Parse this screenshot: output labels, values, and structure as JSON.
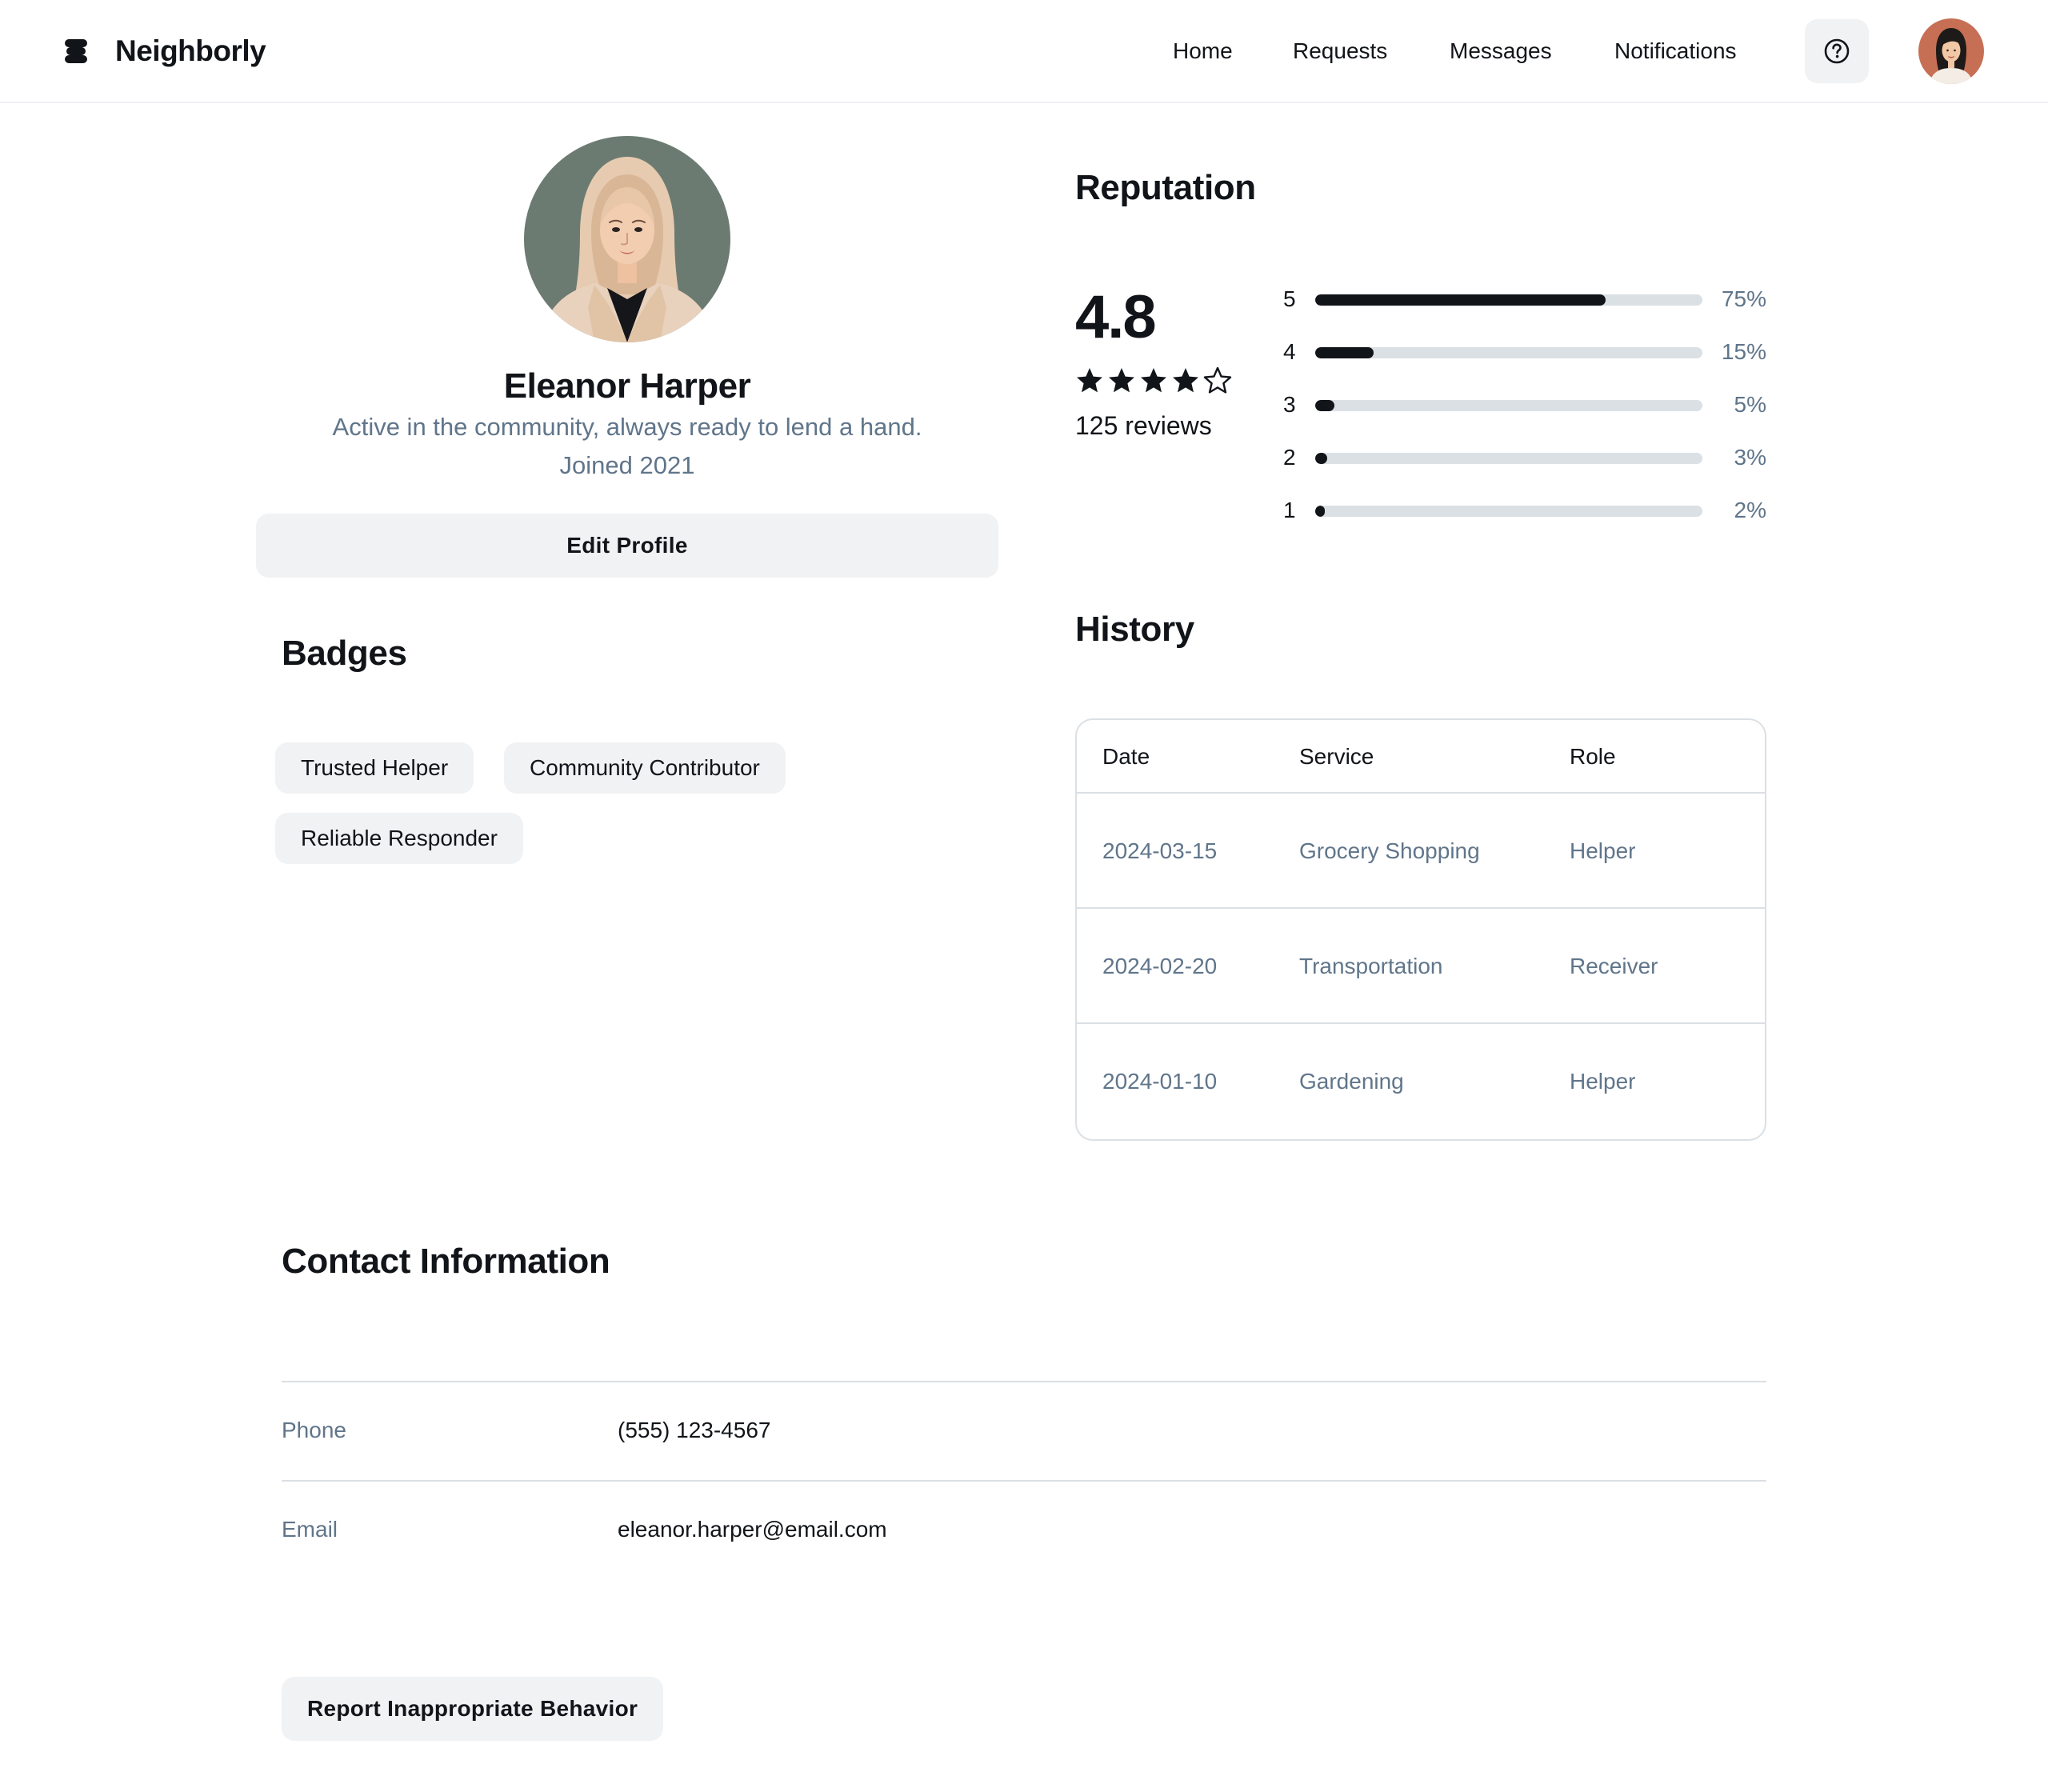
{
  "app": {
    "name": "Neighborly"
  },
  "nav": {
    "items": [
      {
        "label": "Home"
      },
      {
        "label": "Requests"
      },
      {
        "label": "Messages"
      },
      {
        "label": "Notifications"
      }
    ],
    "help_icon": "help-circle-icon"
  },
  "profile": {
    "name": "Eleanor Harper",
    "bio": "Active in the community, always ready to lend a hand.",
    "joined": "Joined 2021",
    "edit_label": "Edit Profile"
  },
  "badges": {
    "title": "Badges",
    "items": [
      "Trusted Helper",
      "Community Contributor",
      "Reliable Responder"
    ]
  },
  "reputation": {
    "title": "Reputation",
    "rating": "4.8",
    "stars_filled": 4,
    "stars_total": 5,
    "reviews": "125 reviews",
    "breakdown": [
      {
        "stars": "5",
        "percent": "75%",
        "value": 75
      },
      {
        "stars": "4",
        "percent": "15%",
        "value": 15
      },
      {
        "stars": "3",
        "percent": "5%",
        "value": 5
      },
      {
        "stars": "2",
        "percent": "3%",
        "value": 3
      },
      {
        "stars": "1",
        "percent": "2%",
        "value": 2
      }
    ]
  },
  "history": {
    "title": "History",
    "columns": [
      "Date",
      "Service",
      "Role"
    ],
    "rows": [
      {
        "date": "2024-03-15",
        "service": "Grocery Shopping",
        "role": "Helper"
      },
      {
        "date": "2024-02-20",
        "service": "Transportation",
        "role": "Receiver"
      },
      {
        "date": "2024-01-10",
        "service": "Gardening",
        "role": "Helper"
      }
    ]
  },
  "contact": {
    "title": "Contact Information",
    "phone_label": "Phone",
    "phone": "(555) 123-4567",
    "email_label": "Email",
    "email": "eleanor.harper@email.com"
  },
  "report": {
    "label": "Report Inappropriate Behavior"
  },
  "colors": {
    "text": "#111418",
    "muted": "#60758a",
    "surface": "#f0f2f4",
    "border": "#dbe0e5"
  }
}
